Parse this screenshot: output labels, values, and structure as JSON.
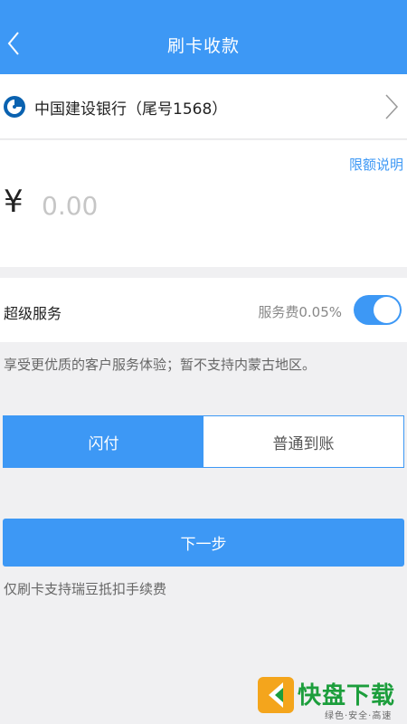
{
  "header": {
    "title": "刷卡收款",
    "back_icon": "chevron-left-icon"
  },
  "bank": {
    "name": "中国建设银行（尾号1568）",
    "logo_icon": "ccb-logo-icon",
    "chevron_icon": "chevron-right-icon"
  },
  "amount": {
    "limit_link": "限额说明",
    "currency_symbol": "¥",
    "placeholder": "0.00",
    "value": ""
  },
  "service": {
    "label": "超级服务",
    "fee": "服务费0.05%",
    "toggle_on": true,
    "description": "享受更优质的客户服务体验；暂不支持内蒙古地区。"
  },
  "settlement": {
    "options": [
      "闪付",
      "普通到账"
    ],
    "selected": "闪付"
  },
  "next_button": "下一步",
  "footnote": "仅刷卡支持瑞豆抵扣手续费",
  "watermark": {
    "big": "快盘下载",
    "small": "绿色·安全·高速"
  },
  "colors": {
    "accent": "#3d98f5",
    "background": "#f0f0f2"
  }
}
